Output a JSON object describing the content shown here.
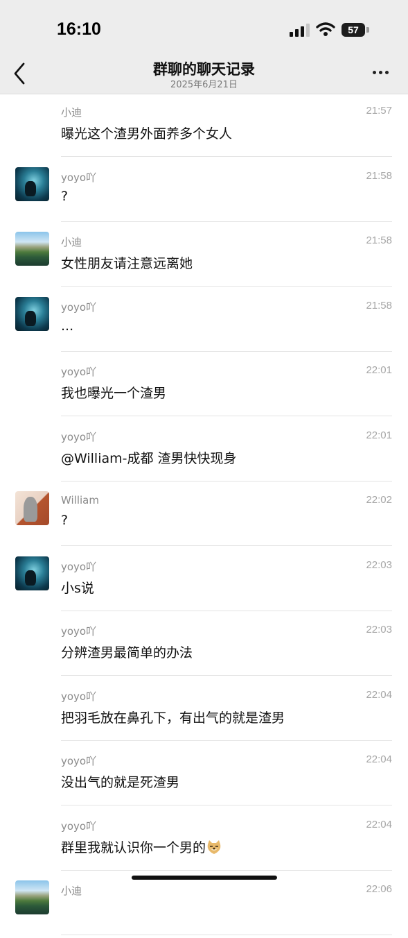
{
  "status_bar": {
    "time": "16:10",
    "battery": "57"
  },
  "nav": {
    "title": "群聊的聊天记录",
    "subtitle": "2025年6月21日",
    "back_icon": "chevron-left-icon",
    "more_icon": "more-dots-icon"
  },
  "messages": [
    {
      "sender": "小迪",
      "time": "21:57",
      "text": "曝光这个渣男外面养多个女人",
      "avatar": ""
    },
    {
      "sender": "yoyo吖",
      "time": "21:58",
      "text": "?",
      "avatar": "ocean"
    },
    {
      "sender": "小迪",
      "time": "21:58",
      "text": "女性朋友请注意远离她",
      "avatar": "mountain"
    },
    {
      "sender": "yoyo吖",
      "time": "21:58",
      "text": "...",
      "avatar": "ocean"
    },
    {
      "sender": "yoyo吖",
      "time": "22:01",
      "text": "我也曝光一个渣男",
      "avatar": ""
    },
    {
      "sender": "yoyo吖",
      "time": "22:01",
      "text": "@William-成都 渣男快快现身",
      "avatar": ""
    },
    {
      "sender": "William",
      "time": "22:02",
      "text": "?",
      "avatar": "william"
    },
    {
      "sender": "yoyo吖",
      "time": "22:03",
      "text": "小s说",
      "avatar": "ocean"
    },
    {
      "sender": "yoyo吖",
      "time": "22:03",
      "text": "分辨渣男最简单的办法",
      "avatar": ""
    },
    {
      "sender": "yoyo吖",
      "time": "22:04",
      "text": "把羽毛放在鼻孔下，有出气的就是渣男",
      "avatar": ""
    },
    {
      "sender": "yoyo吖",
      "time": "22:04",
      "text": "没出气的就是死渣男",
      "avatar": ""
    },
    {
      "sender": "yoyo吖",
      "time": "22:04",
      "text": "群里我就认识你一个男的",
      "avatar": "",
      "emoji": "doge-emoji"
    },
    {
      "sender": "小迪",
      "time": "22:06",
      "text": "",
      "avatar": "mountain"
    }
  ],
  "colors": {
    "topbar_bg": "#ededed",
    "name_text": "#8a8a8a",
    "time_text": "#a6a6a6",
    "divider": "#e3e3e3"
  }
}
